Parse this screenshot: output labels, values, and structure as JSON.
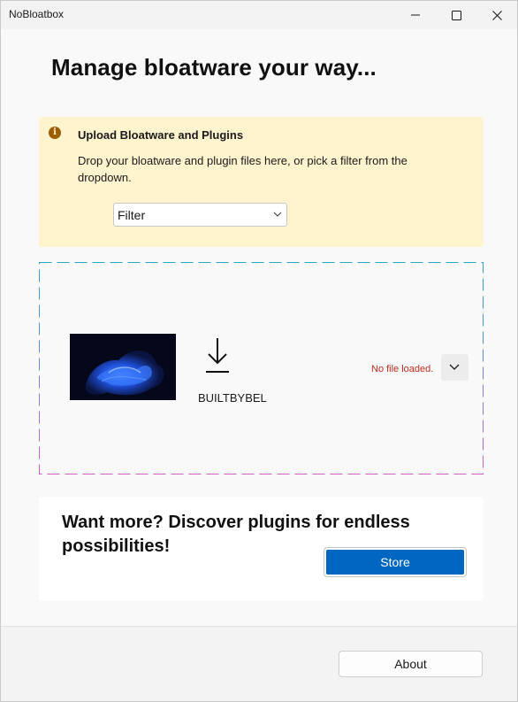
{
  "window": {
    "title": "NoBloatbox",
    "controls": {
      "minimize_icon": "minimize-icon",
      "maximize_icon": "maximize-icon",
      "close_icon": "close-icon"
    }
  },
  "header": {
    "title": "Manage bloatware your way..."
  },
  "infobar": {
    "icon": "info-icon",
    "icon_glyph": "i",
    "title": "Upload Bloatware and Plugins",
    "message": "Drop your bloatware and plugin files here, or pick a filter from the dropdown.",
    "filter": {
      "selected": "Filter",
      "icon": "chevron-down-icon"
    },
    "colors": {
      "background": "#fff4ce",
      "icon": "#9d5d00"
    }
  },
  "dropzone": {
    "image": "windows-bloom-wallpaper",
    "download_icon": "download-icon",
    "brand_label": "BUILTBYBEL",
    "status": "No file loaded.",
    "expand_icon": "chevron-down-icon",
    "colors": {
      "dash_top": "#2aa8c6",
      "dash_bottom": "#d35cc8",
      "status": "#c42b1c"
    }
  },
  "promo": {
    "text": "Want more? Discover plugins for endless possibilities!",
    "store_label": "Store",
    "colors": {
      "accent": "#0067c0"
    }
  },
  "footer": {
    "about_label": "About"
  }
}
